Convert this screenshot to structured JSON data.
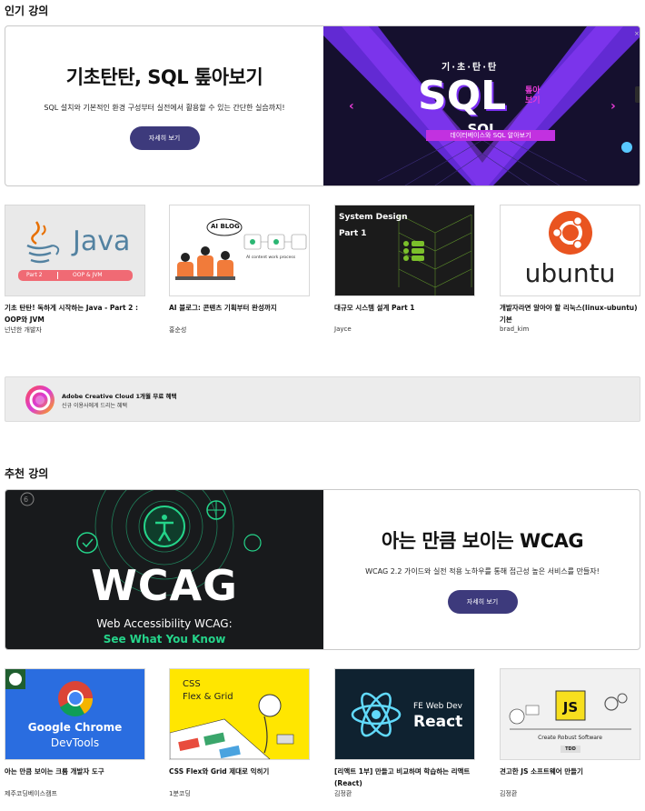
{
  "popular": {
    "section_title": "인기 강의",
    "hero": {
      "title": "기초탄탄, SQL 톺아보기",
      "description": "SQL 설치와 기본적인 환경 구성부터 실전에서 활용할 수 있는 간단한 실습까지!",
      "button_label": "자세히 보기",
      "image": {
        "top_text": "기·초·탄·탄",
        "main_text": "SQL",
        "side_text_1": "톺아",
        "side_text_2": "보기",
        "caption": "데이터베이스와 SQL 알아보기"
      }
    },
    "cards": [
      {
        "title": "기초 탄탄! 독하게 시작하는 Java - Part 2 : OOP와 JVM",
        "author": "넌넌한 개발자",
        "thumb": {
          "logo_text": "Java",
          "bar_left": "Part 2",
          "bar_right": "OOP & JVM"
        }
      },
      {
        "title": "AI 블로그: 콘텐츠 기획부터 완성까지",
        "author": "홍순성",
        "thumb": {
          "bubble": "AI BLOG",
          "caption": "AI content work process"
        }
      },
      {
        "title": "대규모 시스템 설계 Part 1",
        "author": "Jayce",
        "thumb": {
          "line1": "System Design",
          "line2": "Part 1"
        }
      },
      {
        "title": "개발자라면 알아야 할 리눅스(linux-ubuntu) 기본",
        "author": "brad_kim",
        "thumb": {
          "logo_text": "ubuntu"
        }
      }
    ]
  },
  "promo": {
    "title": "Adobe Creative Cloud 1개월 무료 혜택",
    "subtitle": "신규 이용사에게 드리는 혜택",
    "icon": "adobe-cc-icon"
  },
  "recommended": {
    "section_title": "추천 강의",
    "hero": {
      "title": "아는 만큼 보이는 WCAG",
      "description": "WCAG 2.2 가이드와 실전 적용 노하우를 통해 접근성 높은 서비스를 만들자!",
      "button_label": "자세히 보기",
      "image": {
        "main_text": "WCAG",
        "sub_line_1": "Web Accessibility WCAG:",
        "sub_line_2": "See What You Know"
      }
    },
    "cards": [
      {
        "title": "아는 만큼 보이는 크롬 개발자 도구",
        "author": "제주코딩베이스캠프",
        "thumb": {
          "line1": "Google Chrome",
          "line2": "DevTools"
        }
      },
      {
        "title": "CSS Flex와 Grid 제대로 익히기",
        "author": "1분코딩",
        "thumb": {
          "line1": "CSS",
          "line2": "Flex & Grid"
        }
      },
      {
        "title": "[리액트 1부] 만들고 비교하며 학습하는 리액트 (React)",
        "author": "김정환",
        "thumb": {
          "line1": "FE Web Dev",
          "line2": "React"
        }
      },
      {
        "title": "견고한 JS 소프트웨어 만들기",
        "author": "김정환",
        "thumb": {
          "logo_text": "JS",
          "caption": "Create Robust Software",
          "tag": "TDD"
        }
      }
    ]
  },
  "colors": {
    "button_bg": "#3d3a7c",
    "sql_purple": "#7b2ff2",
    "wcag_green": "#25d48a"
  }
}
